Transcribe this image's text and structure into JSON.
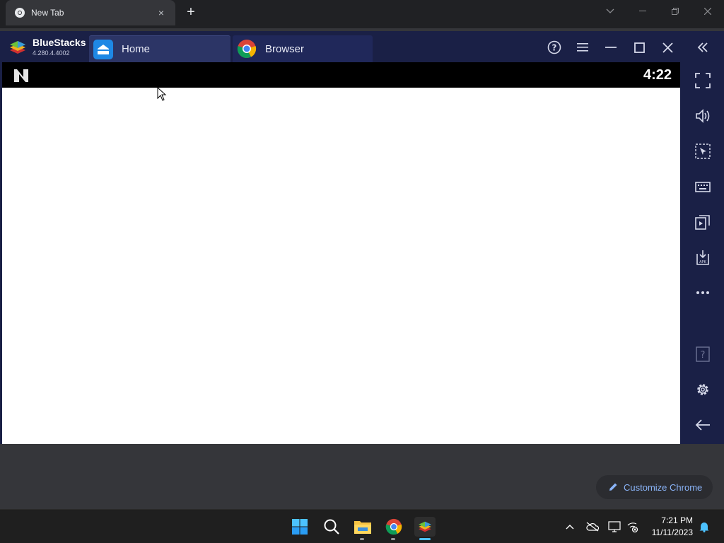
{
  "chrome": {
    "tab_title": "New Tab",
    "tab_close": "×",
    "new_tab": "+"
  },
  "bluestacks": {
    "app_name": "BlueStacks",
    "version": "4.280.4.4002",
    "tabs": [
      {
        "label": "Home",
        "icon": "home-icon"
      },
      {
        "label": "Browser",
        "icon": "chrome-icon"
      }
    ],
    "title_controls": [
      "help-icon",
      "menu-icon",
      "minimize-icon",
      "maximize-icon",
      "close-icon",
      "collapse-sidebar-icon"
    ],
    "sidebar": [
      "fullscreen-icon",
      "volume-icon",
      "select-area-icon",
      "keyboard-icon",
      "multi-instance-icon",
      "install-apk-icon",
      "more-icon",
      "help-icon",
      "settings-icon",
      "back-icon"
    ],
    "accent": "#1a2046"
  },
  "android": {
    "clock": "4:22",
    "status_icon": "n-logo-icon"
  },
  "customize": {
    "label": "Customize Chrome",
    "icon": "pencil-icon",
    "color": "#8ab4f8"
  },
  "taskbar": {
    "apps": [
      "windows-start-icon",
      "search-icon",
      "file-explorer-icon",
      "chrome-icon",
      "bluestacks-icon"
    ],
    "tray": [
      "chevron-up-icon",
      "onedrive-icon",
      "display-icon",
      "network-icon",
      "notification-bell-icon"
    ],
    "time": "7:21 PM",
    "date": "11/11/2023"
  }
}
